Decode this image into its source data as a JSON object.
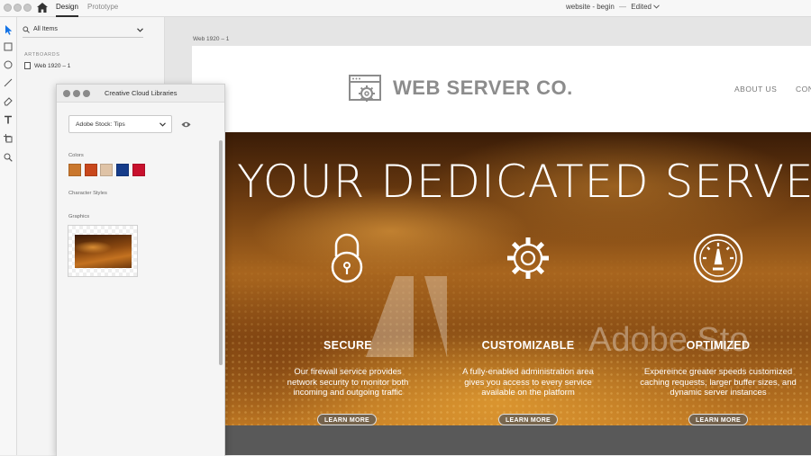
{
  "titlebar": {
    "tabs": [
      {
        "label": "Design"
      },
      {
        "label": "Prototype"
      }
    ],
    "doc_name": "website - begin",
    "doc_sep": "—",
    "doc_status": "Edited"
  },
  "layers_panel": {
    "assets_filter": "All Items",
    "section_title": "ARTBOARDS",
    "artboards": [
      {
        "name": "Web 1920 – 1"
      }
    ]
  },
  "canvas": {
    "artboard_label": "Web 1920 – 1"
  },
  "site": {
    "brand": "WEB SERVER CO.",
    "nav": [
      "ABOUT US",
      "CON"
    ],
    "hero_title": "YOUR DEDICATED SERVER",
    "watermark": "Adobe Sto",
    "features": [
      {
        "icon": "padlock-icon",
        "title": "SECURE",
        "desc": [
          "Our firewall service provides",
          "network security to monitor both",
          "incoming and outgoing traffic"
        ],
        "button": "LEARN MORE"
      },
      {
        "icon": "gear-icon",
        "title": "CUSTOMIZABLE",
        "desc": [
          "A fully-enabled administration area",
          "gives you access to every service",
          "available on the platform"
        ],
        "button": "LEARN MORE"
      },
      {
        "icon": "speedometer-icon",
        "title": "OPTIMIZED",
        "desc": [
          "Expereince greater speeds customized",
          "caching requests, larger buffer sizes, and",
          "dynamic server instances"
        ],
        "button": "LEARN MORE"
      }
    ]
  },
  "library_panel": {
    "title": "Creative Cloud Libraries",
    "library": "Adobe Stock: Tips",
    "colors_label": "Colors",
    "colors": [
      "#c9772d",
      "#c8471c",
      "#dfc3a6",
      "#163c8a",
      "#c8112d"
    ],
    "char_styles_label": "Character Styles",
    "graphics_label": "Graphics"
  }
}
